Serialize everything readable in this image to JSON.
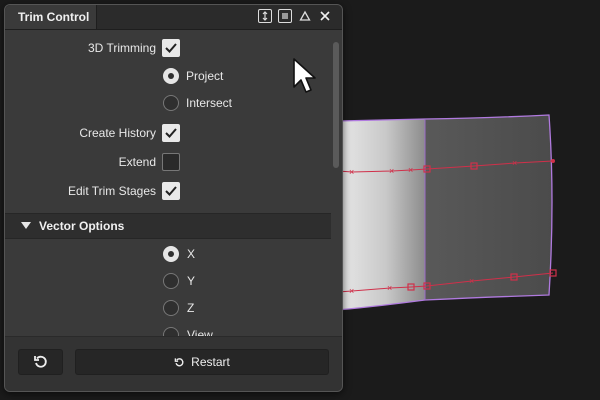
{
  "panel": {
    "tab_title": "Trim Control",
    "title_icons": [
      "expand-vertical-icon",
      "list-menu-icon",
      "collapse-up-icon",
      "close-icon"
    ]
  },
  "options": {
    "trimming_3d": {
      "label": "3D Trimming",
      "checked": true
    },
    "project": {
      "label": "Project",
      "selected": true
    },
    "intersect": {
      "label": "Intersect",
      "selected": false
    },
    "create_history": {
      "label": "Create History",
      "checked": true
    },
    "extend": {
      "label": "Extend",
      "checked": false
    },
    "edit_trim_stages": {
      "label": "Edit Trim Stages",
      "checked": true
    }
  },
  "vector_options": {
    "title": "Vector Options",
    "items": [
      {
        "label": "X",
        "selected": true
      },
      {
        "label": "Y",
        "selected": false
      },
      {
        "label": "Z",
        "selected": false
      },
      {
        "label": "View",
        "selected": false
      }
    ]
  },
  "footer": {
    "reset_icon": "rotate-ccw-icon",
    "restart_label": "Restart"
  },
  "colors": {
    "panel_bg": "#3a3a3a",
    "titlebar_bg": "#2b2b2b",
    "surface_outline": "#b07adf",
    "curve_color": "#d0304a",
    "viewport_bg": "#1b1b1b"
  }
}
